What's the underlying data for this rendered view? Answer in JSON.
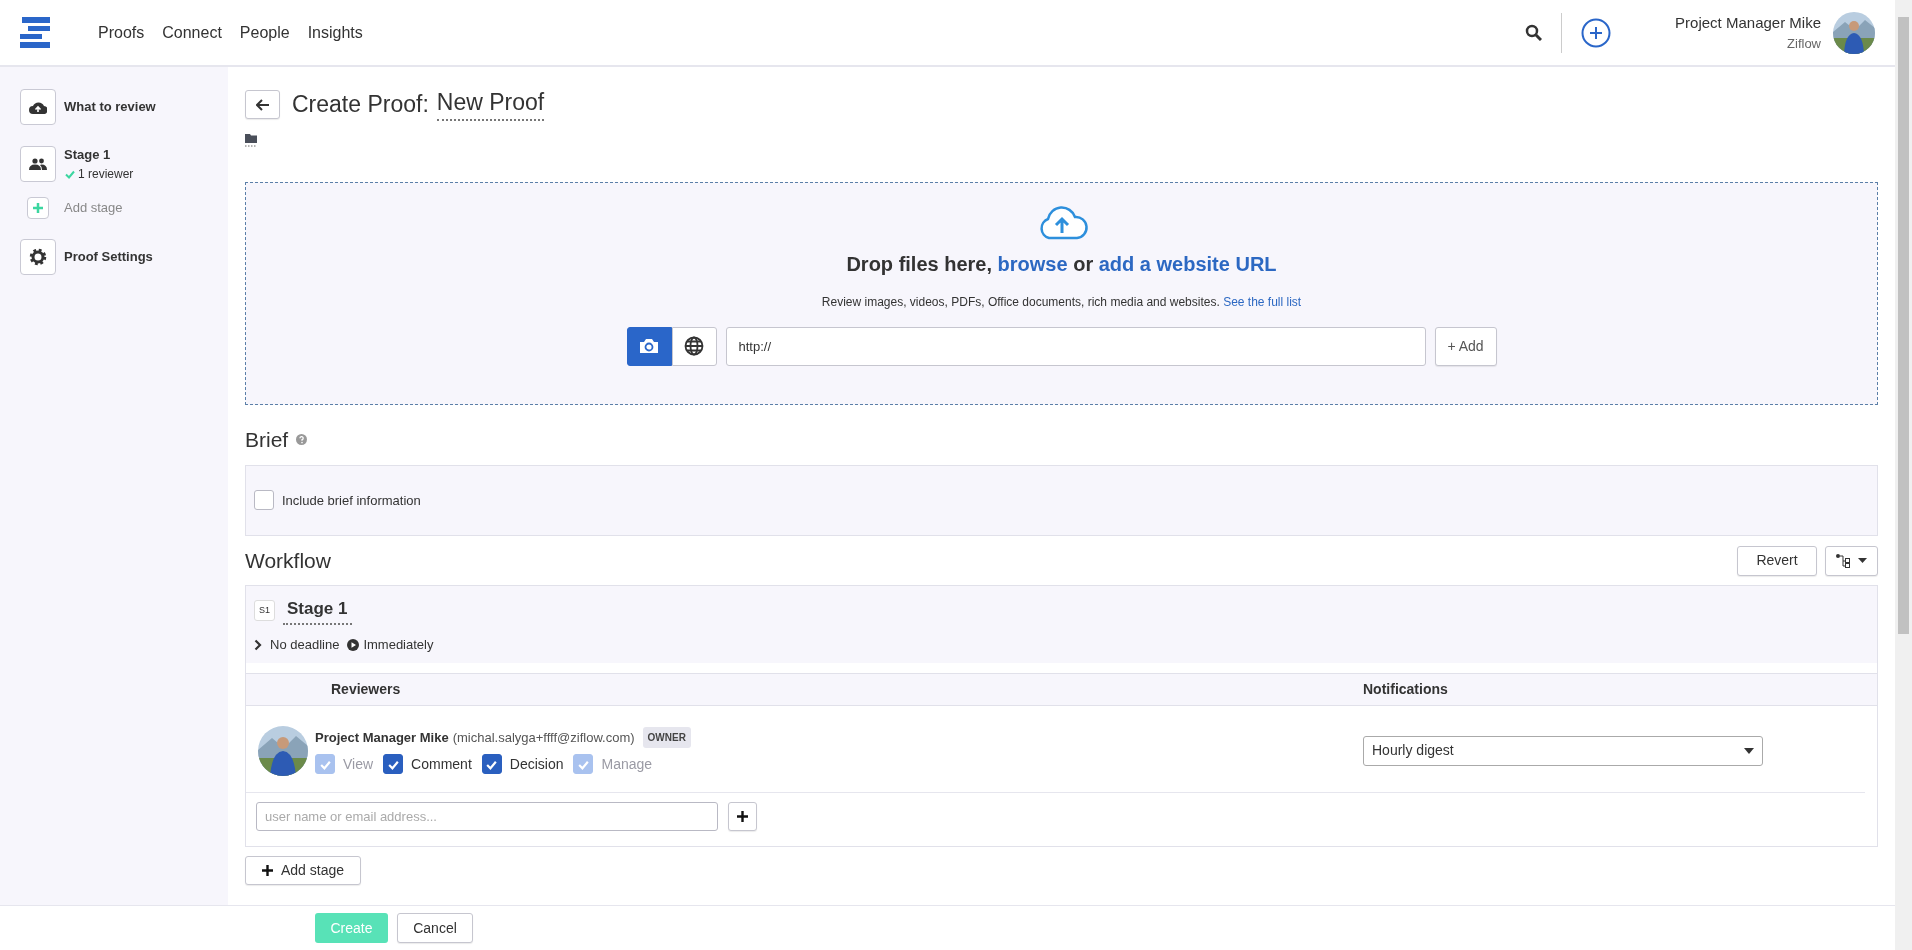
{
  "nav": {
    "items": [
      "Proofs",
      "Connect",
      "People",
      "Insights"
    ]
  },
  "user": {
    "name": "Project Manager Mike",
    "organization": "Ziflow"
  },
  "sidebar": {
    "items": [
      {
        "kind": "upload",
        "label": "What to review"
      },
      {
        "kind": "stage",
        "label": "Stage 1",
        "status": "1 reviewer"
      },
      {
        "kind": "add",
        "label": "Add stage"
      },
      {
        "kind": "settings",
        "label": "Proof Settings"
      }
    ]
  },
  "page": {
    "title_prefix": "Create Proof:",
    "title": "New Proof"
  },
  "upload": {
    "heading_start": "Drop files here,",
    "browse_link": "browse",
    "heading_or": "or",
    "url_link": "add a website URL",
    "description": "Review images, videos, PDFs, Office documents, rich media and websites.",
    "full_list_link": "See the full list",
    "sources": [
      {
        "kind": "camera",
        "selected": true
      },
      {
        "kind": "web",
        "selected": false
      }
    ],
    "url_field": {
      "value": "http://"
    },
    "add_button": "+ Add"
  },
  "brief": {
    "heading": "Brief",
    "checkbox": {
      "label": "Include brief information",
      "checked": false
    }
  },
  "workflow": {
    "heading": "Workflow",
    "revert_button": "Revert",
    "stages": [
      {
        "badge": "S1",
        "name": "Stage 1",
        "deadline": "No deadline",
        "start": "Immediately",
        "columns": [
          "Reviewers",
          "Notifications"
        ],
        "reviewers": [
          {
            "name": "Project Manager Mike",
            "email": "(michal.salyga+ffff@ziflow.com)",
            "role": "OWNER",
            "permissions": [
              {
                "label": "View",
                "checked": true,
                "disabled": true
              },
              {
                "label": "Comment",
                "checked": true,
                "disabled": false
              },
              {
                "label": "Decision",
                "checked": true,
                "disabled": false
              },
              {
                "label": "Manage",
                "checked": true,
                "disabled": true
              }
            ],
            "notifications": "Hourly digest"
          }
        ],
        "add_reviewer": {
          "placeholder": "user name or email address..."
        }
      }
    ],
    "add_stage_button": "Add stage"
  },
  "footer": {
    "create_button": "Create",
    "cancel_button": "Cancel"
  }
}
